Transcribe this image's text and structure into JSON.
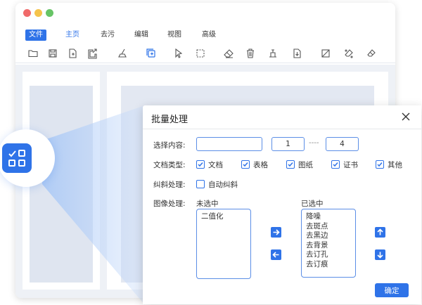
{
  "menu": {
    "file": "文件",
    "home": "主页",
    "decontaminate": "去污",
    "edit": "编辑",
    "view": "视图",
    "advanced": "高级"
  },
  "toolbar_icons": [
    "open-folder-icon",
    "save-icon",
    "import-icon",
    "export-icon",
    "sweep-icon",
    "batch-icon",
    "select-pointer-icon",
    "marquee-select-icon",
    "eraser-icon",
    "delete-icon",
    "crop-icon",
    "download-icon",
    "deskew-icon",
    "erase-stain-icon",
    "remove-mark-icon"
  ],
  "colors": {
    "accent": "#2f73e8",
    "border": "#5b8ee6",
    "workspace": "#eef1f6"
  },
  "dialog": {
    "title": "批量处理",
    "select_content": {
      "label": "选择内容:",
      "value": "",
      "range_from": "1",
      "range_separator": "----",
      "range_to": "4"
    },
    "doc_type": {
      "label": "文档类型:",
      "options": [
        {
          "label": "文档",
          "checked": true
        },
        {
          "label": "表格",
          "checked": true
        },
        {
          "label": "图纸",
          "checked": true
        },
        {
          "label": "证书",
          "checked": true
        },
        {
          "label": "其他",
          "checked": true
        }
      ]
    },
    "deskew": {
      "label": "纠斜处理:",
      "option": "自动纠斜",
      "checked": false
    },
    "image": {
      "label": "图像处理:",
      "unselected_title": "未选中",
      "selected_title": "已选中",
      "unselected_items": [
        "二值化"
      ],
      "selected_items": [
        "降噪",
        "去斑点",
        "去黑边",
        "去背景",
        "去订孔",
        "去订痕"
      ]
    },
    "ok_label": "确定"
  }
}
